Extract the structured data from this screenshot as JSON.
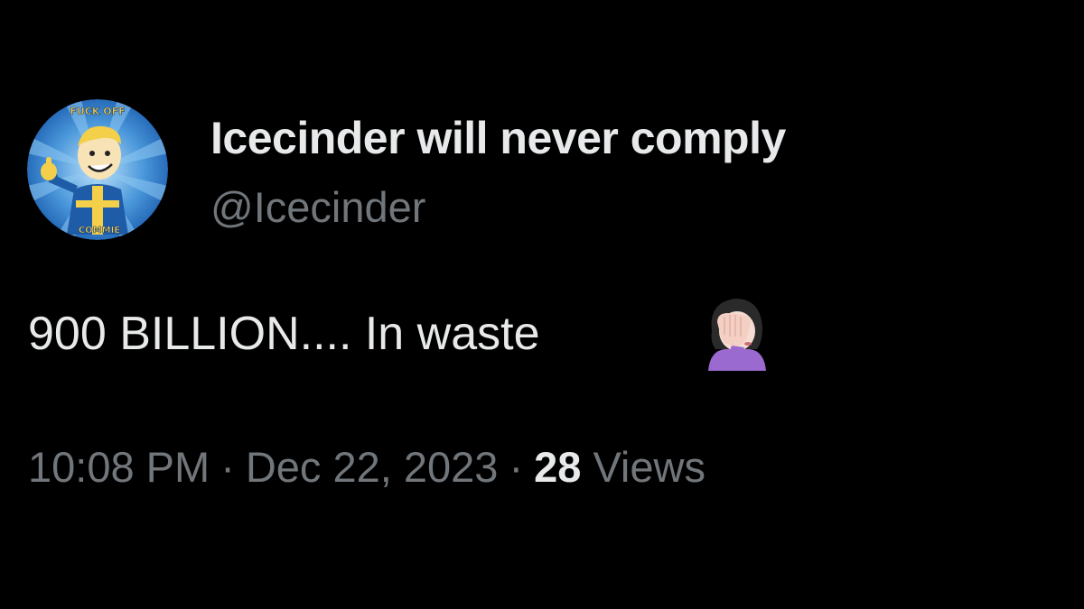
{
  "tweet": {
    "display_name": "Icecinder will never comply",
    "handle": "@Icecinder",
    "text": "900 BILLION.... In waste",
    "emoji": "face-palm-emoji",
    "time": "10:08 PM",
    "date": "Dec 22, 2023",
    "separator": "·",
    "views_count": "28",
    "views_label": "Views"
  },
  "avatar": {
    "top_text": "FUCK OFF",
    "bottom_text": "COMMIE",
    "colors": {
      "bg_blue": "#2b77c9",
      "ray_light": "#8ec9f2",
      "figure_yellow": "#f4cf4a",
      "suit_blue": "#1f5ca8"
    }
  },
  "colors": {
    "background": "#000000",
    "primary_text": "#e7e9ea",
    "secondary_text": "#71767b"
  }
}
